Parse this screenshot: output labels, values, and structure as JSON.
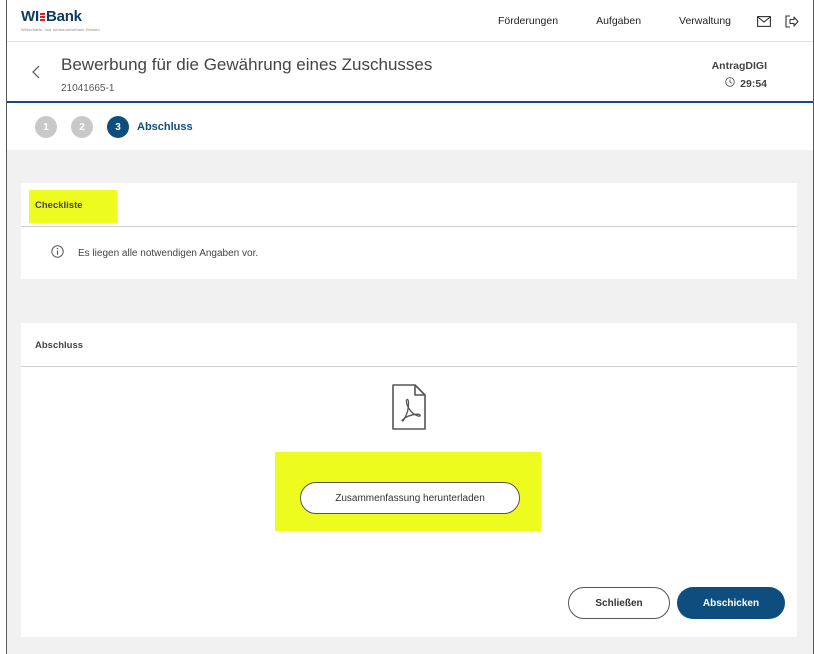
{
  "brand": {
    "logo_left": "WI",
    "logo_right": "Bank",
    "tagline": "Wirtschafts- und Infrastrukturbank Hessen",
    "primary_color": "#0e4e7e",
    "accent_color": "#d6232a",
    "highlight_color": "#eefb1f"
  },
  "nav": {
    "items": [
      {
        "label": "Förderungen"
      },
      {
        "label": "Aufgaben"
      },
      {
        "label": "Verwaltung"
      }
    ],
    "mail_icon": "mail-icon",
    "logout_icon": "logout-icon"
  },
  "header": {
    "title": "Bewerbung für die Gewährung eines Zuschusses",
    "id": "21041665-1",
    "app_name": "AntragDIGI",
    "timer": "29:54"
  },
  "steps": {
    "items": [
      {
        "number": "1"
      },
      {
        "number": "2"
      },
      {
        "number": "3",
        "label": "Abschluss"
      }
    ],
    "active_index": 2
  },
  "checklist": {
    "title": "Checkliste",
    "message": "Es liegen alle notwendigen Angaben vor."
  },
  "abschluss": {
    "title": "Abschluss",
    "download_label": "Zusammenfassung herunterladen",
    "close_label": "Schließen",
    "submit_label": "Abschicken"
  }
}
